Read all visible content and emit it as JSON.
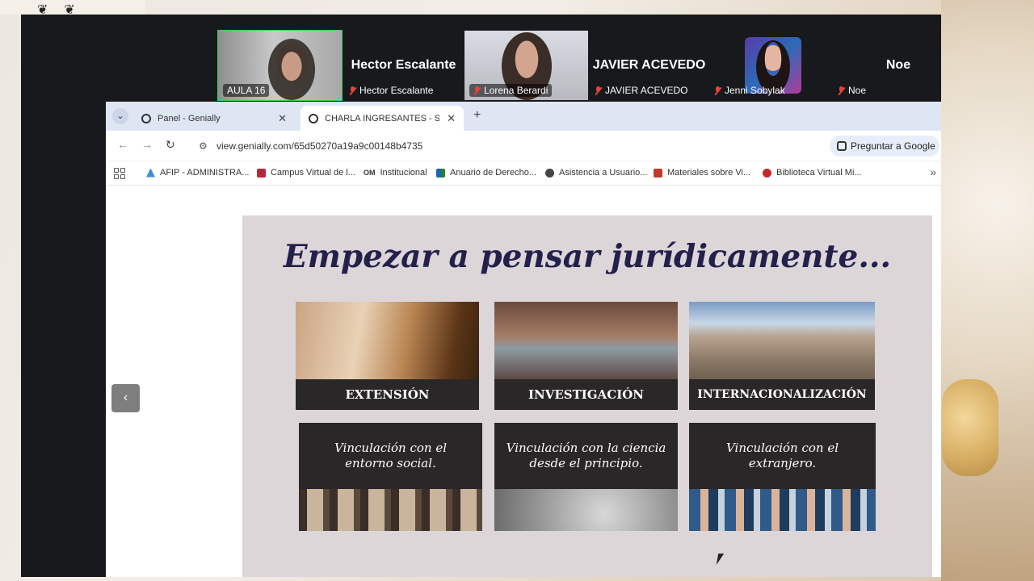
{
  "meeting": {
    "participants": [
      {
        "name_tag": "AULA 16",
        "speaking": true
      },
      {
        "big_name": "Hector Escalante",
        "name_tag": "Hector Escalante",
        "muted": true
      },
      {
        "name_tag": "Lorena Berardi",
        "muted": true
      },
      {
        "big_name": "JAVIER ACEVEDO",
        "name_tag": "JAVIER ACEVEDO",
        "muted": true
      },
      {
        "name_tag": "Jenni Sobylak",
        "muted": true
      },
      {
        "big_name": "Noe",
        "name_tag": "Noe",
        "muted": true
      }
    ]
  },
  "browser": {
    "tabs": [
      {
        "label": "Panel - Genially",
        "active": false
      },
      {
        "label": "CHARLA INGRESANTES - SEDE",
        "active": true
      }
    ],
    "url": "view.genially.com/65d50270a19a9c00148b4735",
    "ask_google": "Preguntar a Google",
    "bookmarks": [
      {
        "label": "AFIP - ADMINISTRA...",
        "color": "#3b8fd6"
      },
      {
        "label": "Campus Virtual de l...",
        "color": "#b3283a"
      },
      {
        "label": "Institucional",
        "color": "#222222",
        "mark": "OM"
      },
      {
        "label": "Anuario de Derecho...",
        "color": "#2e7d32"
      },
      {
        "label": "Asistencia a Usuario...",
        "color": "#444444"
      },
      {
        "label": "Materiales sobre Vi...",
        "color": "#c0392b"
      },
      {
        "label": "Biblioteca Virtual Mi...",
        "color": "#c62828"
      }
    ]
  },
  "slide": {
    "title": "Empezar a pensar jurídicamente...",
    "cards_top": [
      {
        "label": "EXTENSIÓN"
      },
      {
        "label": "INVESTIGACIÓN"
      },
      {
        "label": "INTERNACIONALIZACIÓN"
      }
    ],
    "cards_bottom": [
      {
        "text": "Vinculación con el entorno social."
      },
      {
        "text": "Vinculación con la ciencia desde el principio."
      },
      {
        "text": "Vinculación con el extranjero."
      }
    ]
  }
}
